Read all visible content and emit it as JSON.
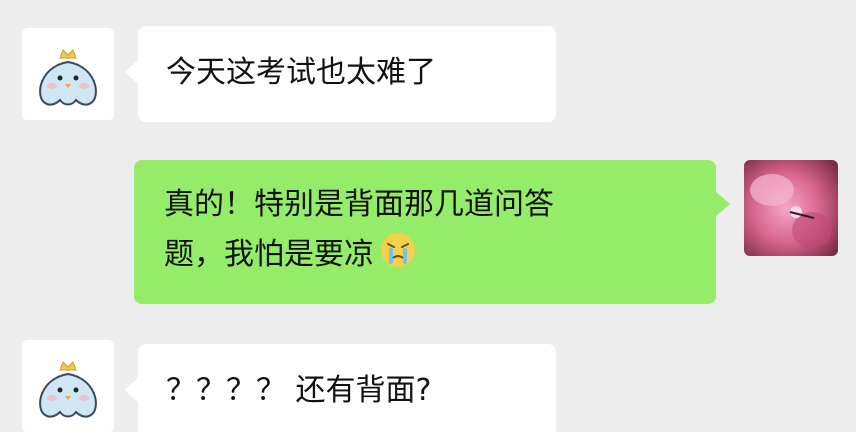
{
  "messages": [
    {
      "side": "left",
      "avatar": "chick-avatar-icon",
      "text": "今天这考试也太难了"
    },
    {
      "side": "right",
      "avatar": "pink-flower-avatar",
      "line1": "真的！特别是背面那几道问答",
      "line2": "题，我怕是要凉",
      "emoji": "crying-emoji"
    },
    {
      "side": "left",
      "avatar": "chick-avatar-icon",
      "text": "？？？？ 还有背面?"
    }
  ],
  "colors": {
    "background": "#ededed",
    "left_bubble": "#ffffff",
    "right_bubble": "#95ec69"
  }
}
